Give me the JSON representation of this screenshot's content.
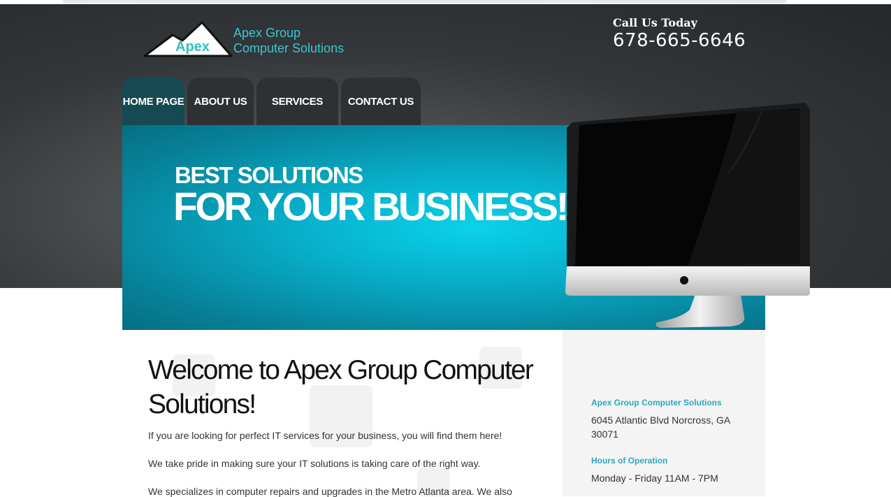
{
  "header": {
    "logo_text": "Apex",
    "company_line1": "Apex Group",
    "company_line2": "Computer Solutions",
    "call_label": "Call Us Today",
    "phone": "678-665-6646"
  },
  "nav": {
    "items": [
      {
        "label": "HOME PAGE",
        "active": true
      },
      {
        "label": "ABOUT US",
        "active": false
      },
      {
        "label": "SERVICES",
        "active": false
      },
      {
        "label": "CONTACT US",
        "active": false
      }
    ]
  },
  "hero": {
    "line1": "BEST SOLUTIONS",
    "line2": "FOR YOUR BUSINESS!"
  },
  "main": {
    "title": "Welcome to Apex Group Computer Solutions!",
    "paragraphs": [
      "If you are looking for perfect IT services for your business, you will find them here!",
      "We take pride in making sure your IT solutions is taking care of the right way.",
      "We specializes in computer repairs and upgrades in the Metro Atlanta area. We also"
    ]
  },
  "sidebar": {
    "company_heading": "Apex Group Computer Solutions",
    "address": "6045 Atlantic Blvd Norcross, GA 30071",
    "hours_heading": "Hours of Operation",
    "hours": "Monday - Friday 11AM - 7PM"
  },
  "colors": {
    "accent": "#2fc0c6",
    "hero": "#08b0cc",
    "nav_bg": "#2e3134",
    "nav_active": "#154a52"
  }
}
